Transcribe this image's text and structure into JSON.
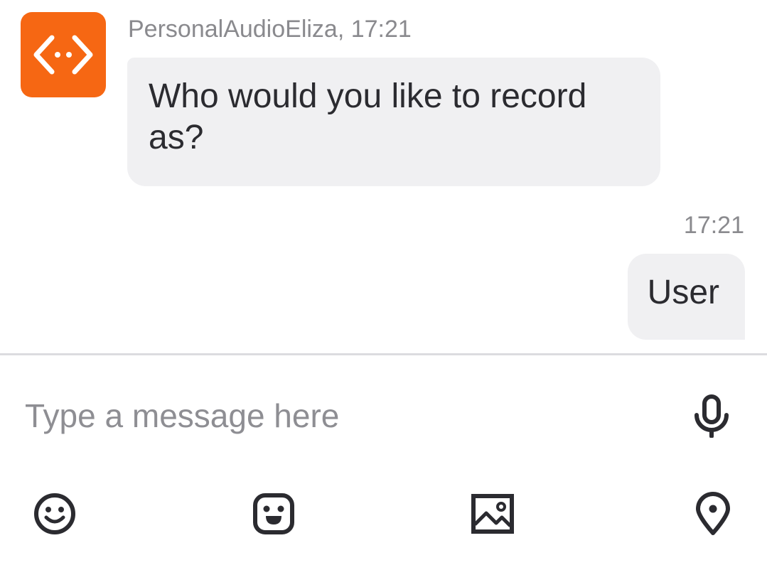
{
  "bot": {
    "avatar_icon": "code-brackets-icon",
    "avatar_color": "#f66713",
    "sender_line": "PersonalAudioEliza, 17:21",
    "message": "Who would you like to record as?"
  },
  "reply": {
    "time": "17:21",
    "message": "User"
  },
  "composer": {
    "placeholder": "Type a message here",
    "mic_icon": "microphone-icon",
    "toolbar": [
      {
        "icon": "emoji-icon"
      },
      {
        "icon": "sticker-icon"
      },
      {
        "icon": "image-icon"
      },
      {
        "icon": "location-pin-icon"
      }
    ]
  }
}
